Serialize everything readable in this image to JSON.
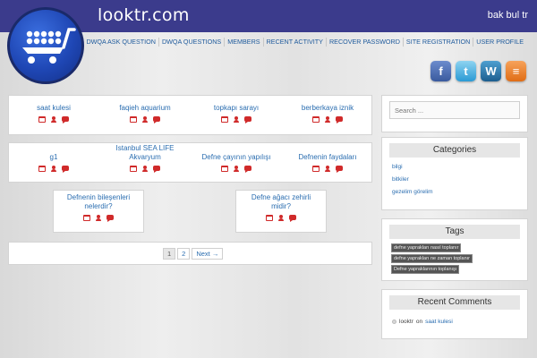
{
  "header": {
    "site_title": "looktr.com",
    "tagline": "bak bul tr"
  },
  "nav": [
    "DWQA ASK QUESTION",
    "DWQA QUESTIONS",
    "MEMBERS",
    "RECENT ACTIVITY",
    "RECOVER PASSWORD",
    "SITE REGISTRATION",
    "USER PROFILE"
  ],
  "social": [
    "facebook-icon",
    "twitter-icon",
    "wordpress-icon",
    "rss-icon"
  ],
  "posts_row1": [
    "saat kulesi",
    "faqieh aquarium",
    "topkapı sarayı",
    "berberkaya iznik"
  ],
  "posts_row2": [
    "g1",
    "Istanbul SEA LIFE Akvaryum",
    "Defne çayının yapılışı",
    "Defnenin faydaları"
  ],
  "posts_row3": [
    "Defnenin bileşenleri nelerdir?",
    "Defne ağacı zehirli midir?"
  ],
  "pagination": {
    "page1": "1",
    "page2": "2",
    "next": "Next →"
  },
  "search": {
    "placeholder": "Search ..."
  },
  "categories": {
    "title": "Categories",
    "items": [
      "bilgi",
      "bitkiler",
      "gezelim görelim"
    ]
  },
  "tags": {
    "title": "Tags",
    "items": [
      "defne yaprakları nasıl toplanır",
      "defne yaprakları ne zaman toplanır",
      "Defne yapraklarının toplanışı"
    ]
  },
  "recent_comments": {
    "title": "Recent Comments",
    "author": "looktr",
    "on": "on",
    "post": "saat kulesi"
  },
  "colors": {
    "header": "#3b3b8c",
    "link": "#2a6db0",
    "icon_red": "#d02a2a"
  }
}
